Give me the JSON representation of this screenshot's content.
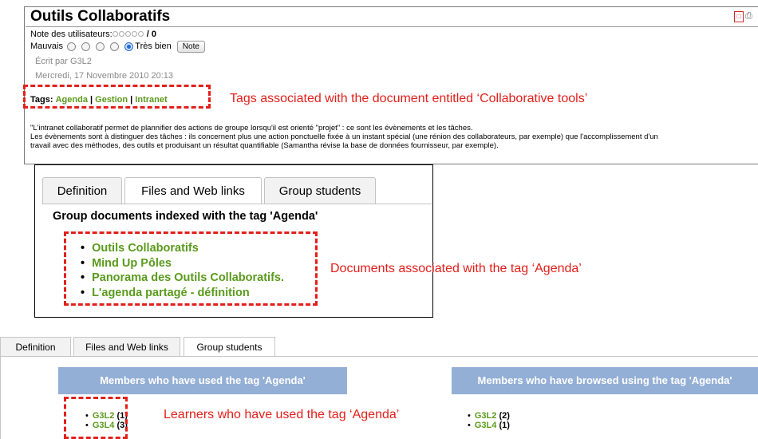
{
  "document": {
    "title": "Outils Collaboratifs",
    "rating_label": "Note des utilisateurs:",
    "rating_value": "/ 0",
    "vote_low": "Mauvais",
    "vote_high": "Très bien",
    "note_button": "Note",
    "author": "Écrit par G3L2",
    "date": "Mercredi, 17 Novembre 2010 20:13",
    "tags_label": "Tags:",
    "tags": [
      "Agenda",
      "Gestion",
      "Intranet"
    ],
    "tag_separator": "|",
    "body_lines": [
      "\"L'intranet collaboratif permet de plannifier des actions de groupe lorsqu'il est orienté \"projet\" : ce sont les évènements et les tâches.",
      "Les évènements sont à distinguer des tâches : ils concernent plus une action ponctuelle fixée à un instant spécial (une rénion des collaborateurs, par exemple) que l'accomplissement d'un",
      "travail avec des méthodes, des outils et produisant un résultat quantifiable (Samantha révise la base de données fournisseur, par exemple)."
    ]
  },
  "annotations": {
    "tags_note": "Tags associated with the document entitled ‘Collaborative tools’",
    "docs_note": "Documents associated with the tag ‘Agenda’",
    "learners_note": "Learners who have used the tag ‘Agenda’"
  },
  "panel2": {
    "tabs": [
      "Definition",
      "Files and Web links",
      "Group students"
    ],
    "heading": "Group documents indexed with the tag 'Agenda'",
    "documents": [
      "Outils Collaboratifs",
      "Mind Up Pôles",
      "Panorama des Outils Collaboratifs.",
      "L'agenda partagé - définition"
    ]
  },
  "panel3": {
    "tabs": [
      "Definition",
      "Files and Web links",
      "Group students"
    ],
    "used_header": "Members who have used the tag 'Agenda'",
    "browsed_header": "Members who have browsed using the tag 'Agenda'",
    "used_members": [
      {
        "name": "G3L2",
        "count": "(1)"
      },
      {
        "name": "G3L4",
        "count": "(3)"
      }
    ],
    "browsed_members": [
      {
        "name": "G3L2",
        "count": "(2)"
      },
      {
        "name": "G3L4",
        "count": "(1)"
      }
    ]
  },
  "colors": {
    "link_green": "#5a9a1c",
    "annotation_red": "#e2201b",
    "header_blue": "#93afd6"
  }
}
